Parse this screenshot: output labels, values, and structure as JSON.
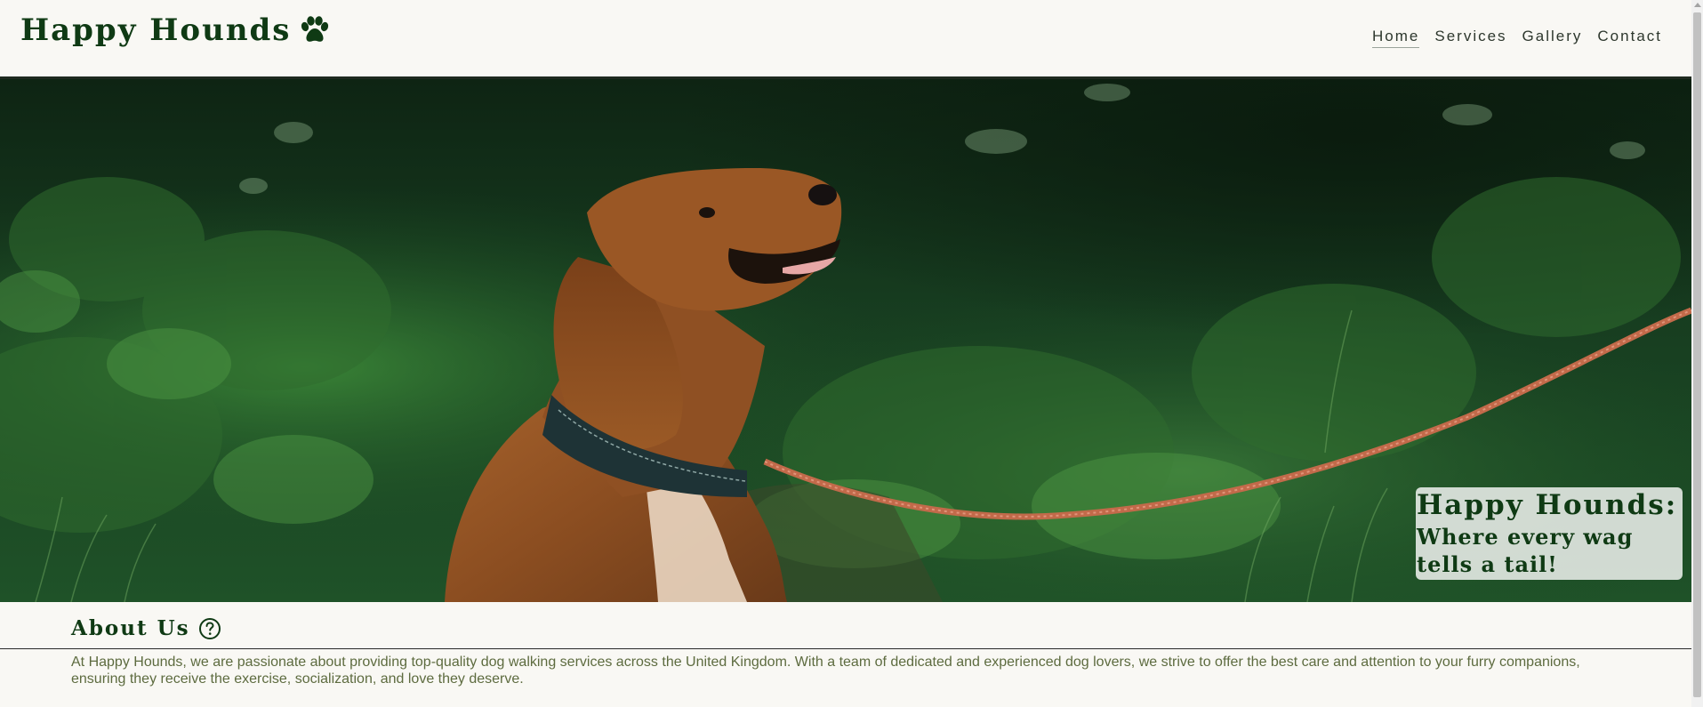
{
  "brand": {
    "name": "Happy Hounds",
    "icon": "paw-icon"
  },
  "nav": {
    "items": [
      {
        "label": "Home",
        "active": true
      },
      {
        "label": "Services",
        "active": false
      },
      {
        "label": "Gallery",
        "active": false
      },
      {
        "label": "Contact",
        "active": false
      }
    ]
  },
  "hero": {
    "image": "dog-on-leash-in-forest",
    "tagline_title": "Happy Hounds:",
    "tagline_sub_line1": "Where every wag",
    "tagline_sub_line2": "tells a tail!"
  },
  "about": {
    "title": "About Us",
    "icon": "help-circle-icon",
    "text": "At Happy Hounds, we are passionate about providing top-quality dog walking services across the United Kingdom. With a team of dedicated and experienced dog lovers, we strive to offer the best care and attention to your furry companions, ensuring they receive the exercise, socialization, and love they deserve."
  },
  "colors": {
    "brand_green": "#0f3a14",
    "background": "#f9f8f4",
    "body_text": "#5d6b3f",
    "nav_text": "#2d372d"
  }
}
